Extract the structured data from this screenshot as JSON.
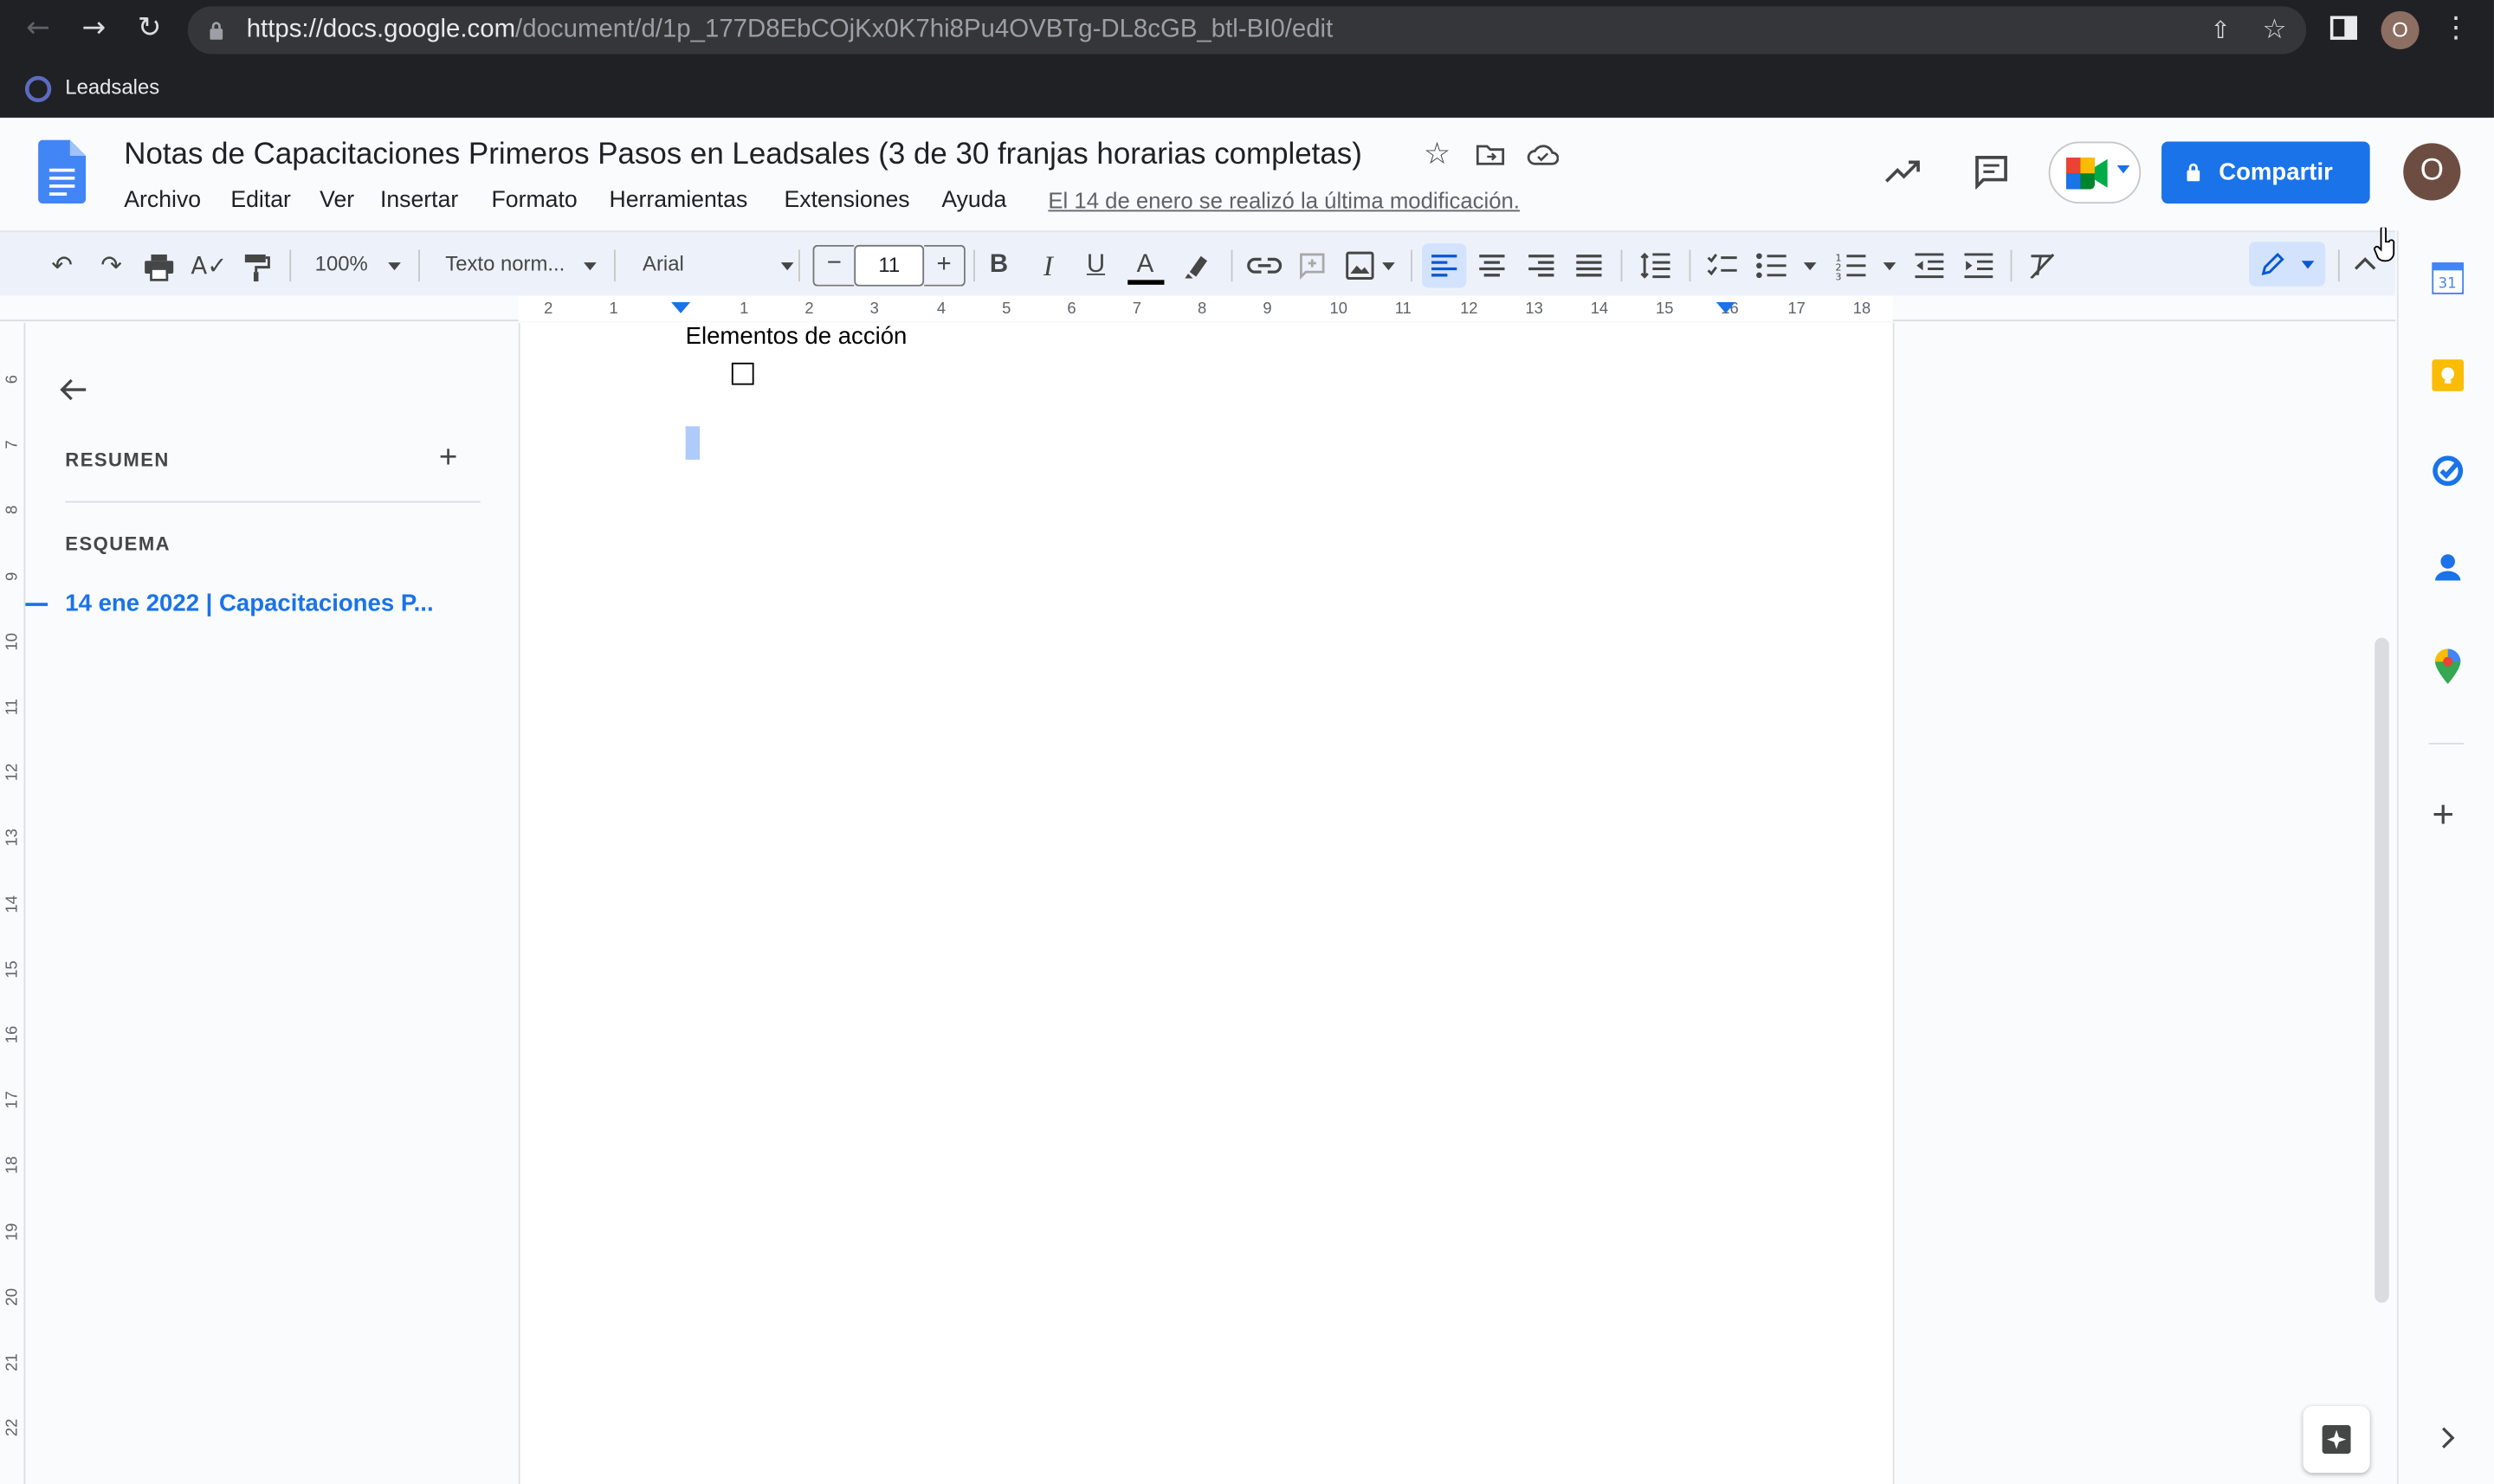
{
  "browser": {
    "url_host": "https://docs.google.com",
    "url_path": "/document/d/1p_177D8EbCOjKx0K7hi8Pu4OVBTg-DL8cGB_btl-BI0/edit",
    "profile_initial": "O",
    "bookmark": "Leadsales"
  },
  "doc": {
    "title": "Notas de Capacitaciones Primeros Pasos en Leadsales (3 de 30 franjas horarias completas)",
    "last_edit": "El 14 de enero se realizó la última modificación.",
    "share_label": "Compartir",
    "avatar_initial": "O"
  },
  "menu": [
    "Archivo",
    "Editar",
    "Ver",
    "Insertar",
    "Formato",
    "Herramientas",
    "Extensiones",
    "Ayuda"
  ],
  "toolbar": {
    "zoom": "100%",
    "style": "Texto norm...",
    "font": "Arial",
    "font_size": "11"
  },
  "ruler": {
    "ticks": [
      "2",
      "1",
      "1",
      "2",
      "3",
      "4",
      "5",
      "6",
      "7",
      "8",
      "9",
      "10",
      "11",
      "12",
      "13",
      "14",
      "15",
      "16",
      "17",
      "18"
    ]
  },
  "vruler": {
    "ticks": [
      "6",
      "7",
      "8",
      "9",
      "10",
      "11",
      "12",
      "13",
      "14",
      "15",
      "16",
      "17",
      "18",
      "19",
      "20",
      "21",
      "22"
    ]
  },
  "outline": {
    "summary_label": "RESUMEN",
    "outline_label": "ESQUEMA",
    "item": "14 ene 2022 | Capacitaciones P..."
  },
  "page": {
    "heading": "Elementos de acción"
  },
  "colors": {
    "accent": "#1a73e8",
    "chrome": "#202124",
    "toolbar": "#edf2fa"
  }
}
